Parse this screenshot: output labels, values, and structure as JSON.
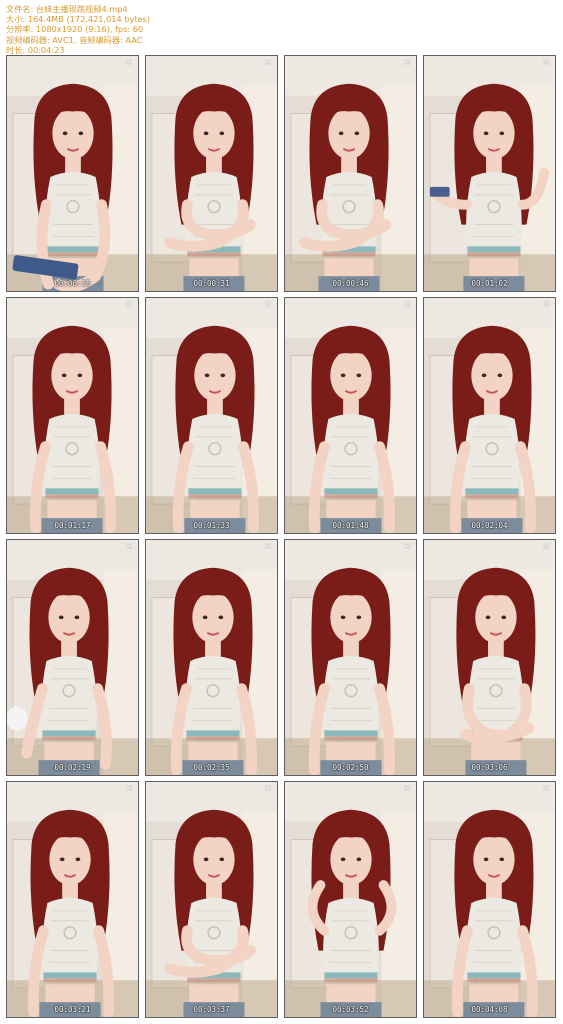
{
  "info": {
    "filename_line": "文件名: 台妹主播现跳视频4.mp4",
    "size_line": "大小: 164.4MB (172,421,014 bytes)",
    "resolution_line": "分辨率: 1080x1920 (9:16), fps: 60",
    "codec_line": "视频编码器: AVC1, 音频编码器: AAC",
    "duration_line": "时长: 00:04:23"
  },
  "thumbnails": [
    {
      "timestamp": "00:00:15",
      "pose": "phone"
    },
    {
      "timestamp": "00:00:31",
      "pose": "arms-cross"
    },
    {
      "timestamp": "00:00:46",
      "pose": "arms-cross"
    },
    {
      "timestamp": "00:01:02",
      "pose": "wave"
    },
    {
      "timestamp": "00:01:17",
      "pose": "down"
    },
    {
      "timestamp": "00:01:33",
      "pose": "down"
    },
    {
      "timestamp": "00:01:48",
      "pose": "down"
    },
    {
      "timestamp": "00:02:04",
      "pose": "down"
    },
    {
      "timestamp": "00:02:19",
      "pose": "plush"
    },
    {
      "timestamp": "00:02:35",
      "pose": "down"
    },
    {
      "timestamp": "00:02:50",
      "pose": "down"
    },
    {
      "timestamp": "00:03:06",
      "pose": "folded"
    },
    {
      "timestamp": "00:03:21",
      "pose": "down"
    },
    {
      "timestamp": "00:03:37",
      "pose": "arms-cross"
    },
    {
      "timestamp": "00:03:52",
      "pose": "hands-up"
    },
    {
      "timestamp": "00:04:08",
      "pose": "down"
    }
  ],
  "close_glyph": "×",
  "colors": {
    "hair": "#7a1d18",
    "skin": "#f2d3c4",
    "top": "#ece8e2",
    "wall": "#e4ddd6",
    "info_text": "#d99a2e"
  }
}
